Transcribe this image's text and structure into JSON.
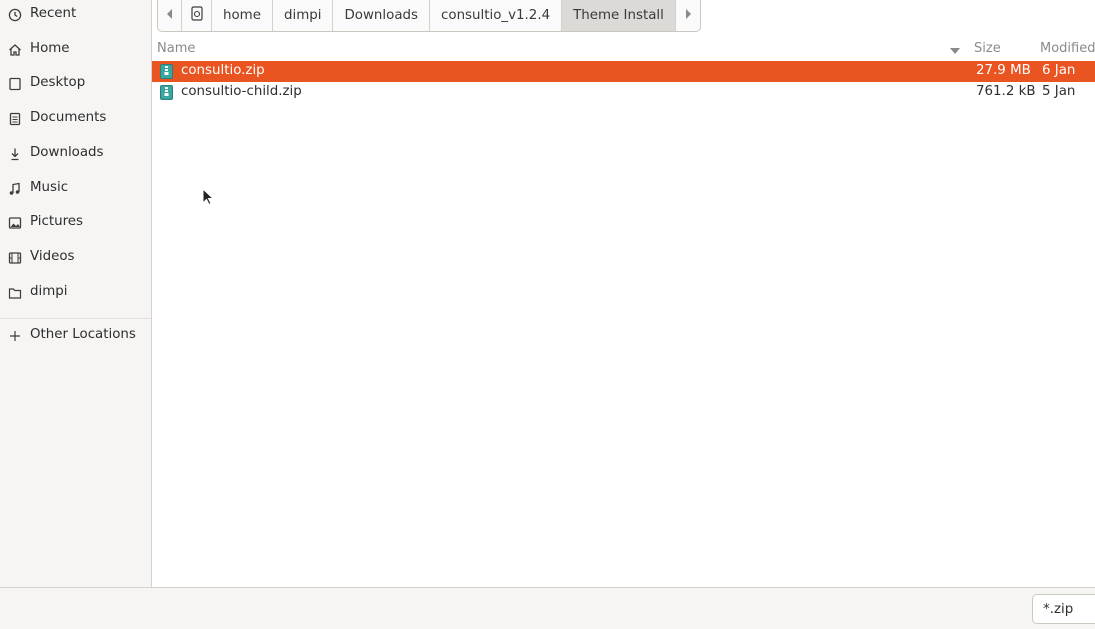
{
  "sidebar": {
    "items": [
      {
        "label": "Recent",
        "icon": "clock-icon"
      },
      {
        "label": "Home",
        "icon": "home-icon"
      },
      {
        "label": "Desktop",
        "icon": "desktop-icon"
      },
      {
        "label": "Documents",
        "icon": "document-icon"
      },
      {
        "label": "Downloads",
        "icon": "download-icon"
      },
      {
        "label": "Music",
        "icon": "music-icon"
      },
      {
        "label": "Pictures",
        "icon": "picture-icon"
      },
      {
        "label": "Videos",
        "icon": "video-icon"
      },
      {
        "label": "dimpi",
        "icon": "folder-icon"
      }
    ],
    "other_locations": {
      "label": "Other Locations",
      "icon": "plus-icon"
    }
  },
  "pathbar": {
    "segments": [
      "home",
      "dimpi",
      "Downloads",
      "consultio_v1.2.4",
      "Theme Install"
    ],
    "active_index": 4
  },
  "columns": {
    "name": "Name",
    "size": "Size",
    "modified": "Modified"
  },
  "files": [
    {
      "name": "consultio.zip",
      "size": "27.9 MB",
      "modified": "6 Jan",
      "selected": true
    },
    {
      "name": "consultio-child.zip",
      "size": "761.2 kB",
      "modified": "5 Jan",
      "selected": false
    }
  ],
  "filter": {
    "value": "*.zip"
  },
  "colors": {
    "accent": "#e95420",
    "sidebar_bg": "#f6f5f4",
    "archive_icon": "#3aa6a0"
  }
}
